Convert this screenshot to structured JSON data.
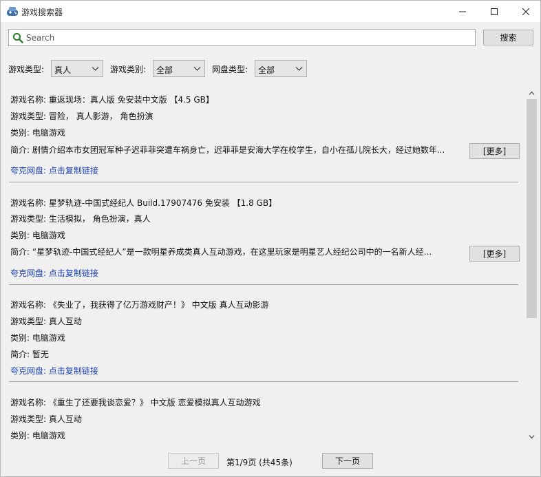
{
  "window": {
    "title": "游戏搜索器",
    "icon": "gamepad-icon"
  },
  "search": {
    "placeholder": "Search",
    "value": "",
    "button_label": "搜索"
  },
  "filters": [
    {
      "label": "游戏类型:",
      "value": "真人"
    },
    {
      "label": "游戏类别:",
      "value": "全部"
    },
    {
      "label": "网盘类型:",
      "value": "全部"
    }
  ],
  "results": [
    {
      "name_line": "游戏名称: 重返现场：真人版 免安装中文版 【4.5 GB】",
      "type_line": "游戏类型:  冒险，  真人影游，  角色扮演",
      "category_line": "类别: 电脑游戏",
      "intro_line": "简介:   剧情介绍本市女团冠军种子迟菲菲突遭车祸身亡，迟菲菲是安海大学在校学生，自小在孤儿院长大，经过她数年...",
      "more_label": "[更多]",
      "link_line": "夸克网盘: 点击复制链接"
    },
    {
      "name_line": "游戏名称: 星梦轨迹-中国式经纪人 Build.17907476 免安装 【1.8 GB】",
      "type_line": "游戏类型:  生活模拟，  角色扮演，真人",
      "category_line": "类别: 电脑游戏",
      "intro_line": "简介:  “星梦轨迹-中国式经纪人”是一款明星养成类真人互动游戏，在这里玩家是明星艺人经纪公司中的一名新人经...",
      "more_label": "[更多]",
      "link_line": "夸克网盘: 点击复制链接"
    },
    {
      "name_line": "游戏名称: 《失业了，我获得了亿万游戏财产！》 中文版 真人互动影游",
      "type_line": "游戏类型: 真人互动",
      "category_line": "类别: 电脑游戏",
      "intro_line": "简介: 暂无",
      "more_label": "",
      "link_line": "夸克网盘: 点击复制链接"
    },
    {
      "name_line": "游戏名称: 《重生了还要我谈恋爱？》 中文版 恋爱模拟真人互动游戏",
      "type_line": "游戏类型: 真人互动",
      "category_line": "类别: 电脑游戏",
      "intro_line": "",
      "more_label": "",
      "link_line": ""
    }
  ],
  "pagination": {
    "prev_label": "上一页",
    "page_info": "第1/9页 (共45条)",
    "next_label": "下一页"
  },
  "colors": {
    "link": "#1a3fb0",
    "window_bg": "#f0f0f0",
    "title_bar": "#ffffff"
  }
}
